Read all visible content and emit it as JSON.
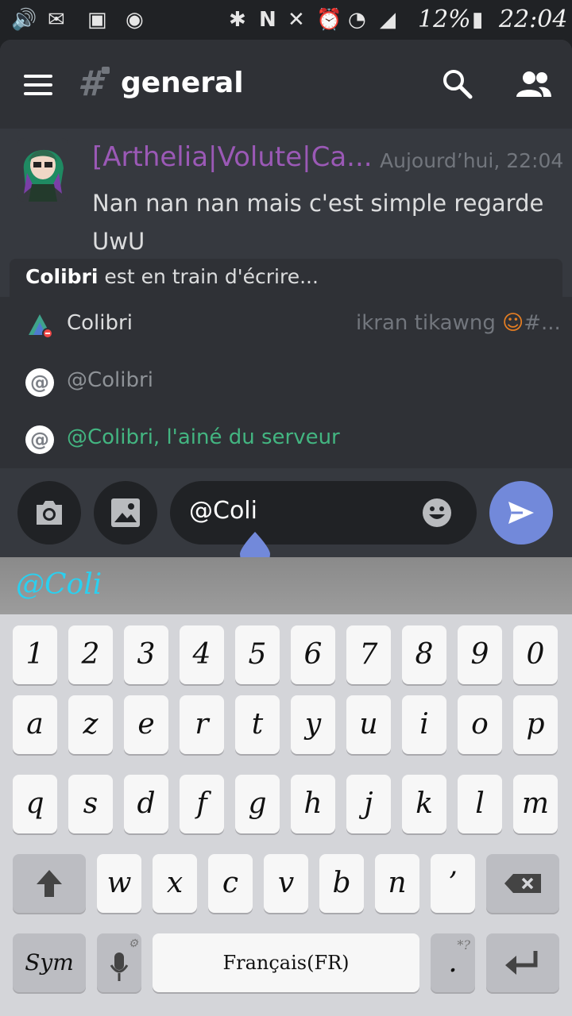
{
  "status": {
    "battery": "12%",
    "time": "22:04"
  },
  "header": {
    "channel": "general"
  },
  "message": {
    "username": "[Arthelia|Volute|Ca...",
    "timestamp": "Aujourd’hui, 22:04",
    "text": "Nan nan nan mais c'est simple regarde UwU"
  },
  "typing": {
    "user": "Colibri",
    "suffix": " est en train d'écrire..."
  },
  "autocomplete": [
    {
      "label": "Colibri",
      "meta": "ikran tikawng",
      "meta_suffix": "#...",
      "color": "#dcddde"
    },
    {
      "label": "@Colibri",
      "color": "#8e9297"
    },
    {
      "label": "@Colibri, l'ainé du serveur",
      "color": "#43b581"
    }
  ],
  "input": {
    "value": "@Coli"
  },
  "keyboard": {
    "suggestion": "@Coli",
    "row1": [
      "1",
      "2",
      "3",
      "4",
      "5",
      "6",
      "7",
      "8",
      "9",
      "0"
    ],
    "row2": [
      "a",
      "z",
      "e",
      "r",
      "t",
      "y",
      "u",
      "i",
      "o",
      "p"
    ],
    "row3": [
      "q",
      "s",
      "d",
      "f",
      "g",
      "h",
      "j",
      "k",
      "l",
      "m"
    ],
    "row4": [
      "w",
      "x",
      "c",
      "v",
      "b",
      "n",
      "’"
    ],
    "sym": "Sym",
    "space": "Français(FR)",
    "period": ".",
    "period_hint": "*?"
  }
}
